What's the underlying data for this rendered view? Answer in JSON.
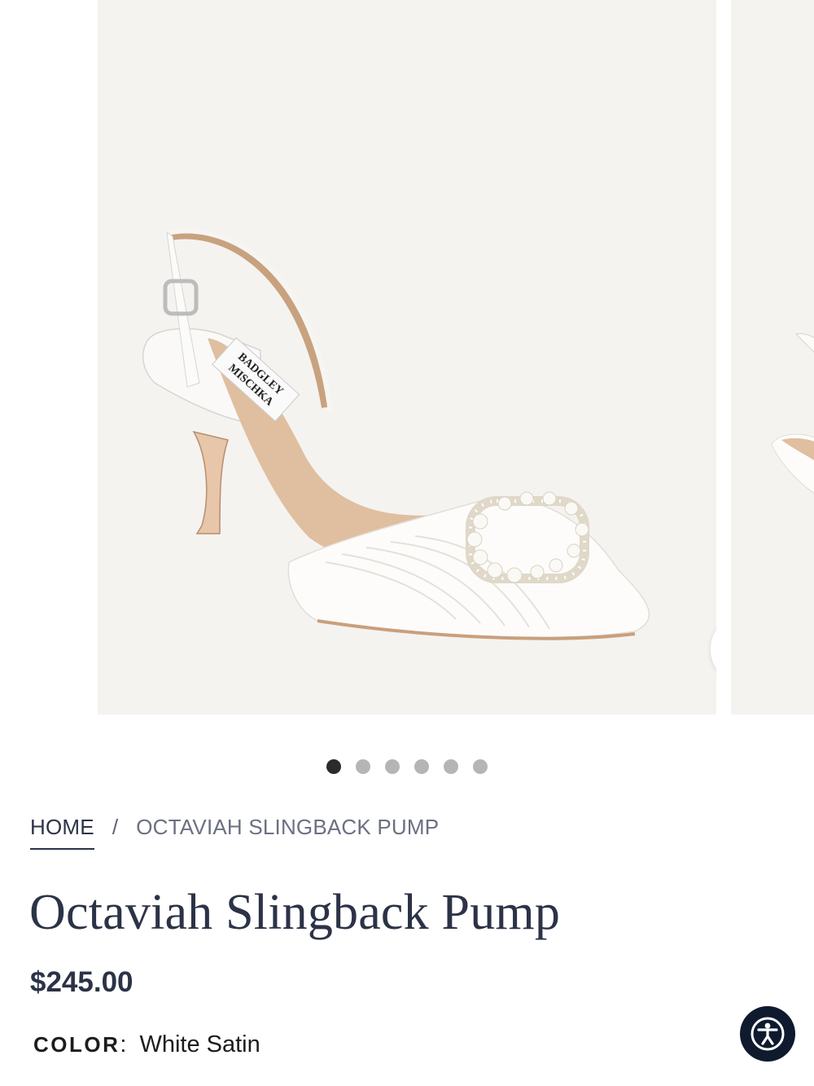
{
  "gallery": {
    "brand_label": "BADGLEY MISCHKA",
    "zoom_icon": "search-icon",
    "dots_total": 6,
    "active_dot": 1
  },
  "breadcrumb": {
    "home": "HOME",
    "separator": "/",
    "current": "OCTAVIAH SLINGBACK PUMP"
  },
  "product": {
    "title": "Octaviah Slingback Pump",
    "price": "$245.00",
    "color_label": "COLOR",
    "color_colon": ":",
    "color_value": "White Satin"
  },
  "accessibility": {
    "icon": "accessibility-icon"
  },
  "colors": {
    "navy": "#2c3347",
    "image_bg": "#f5f3f0",
    "a11y_bg": "#0f1a2e"
  }
}
